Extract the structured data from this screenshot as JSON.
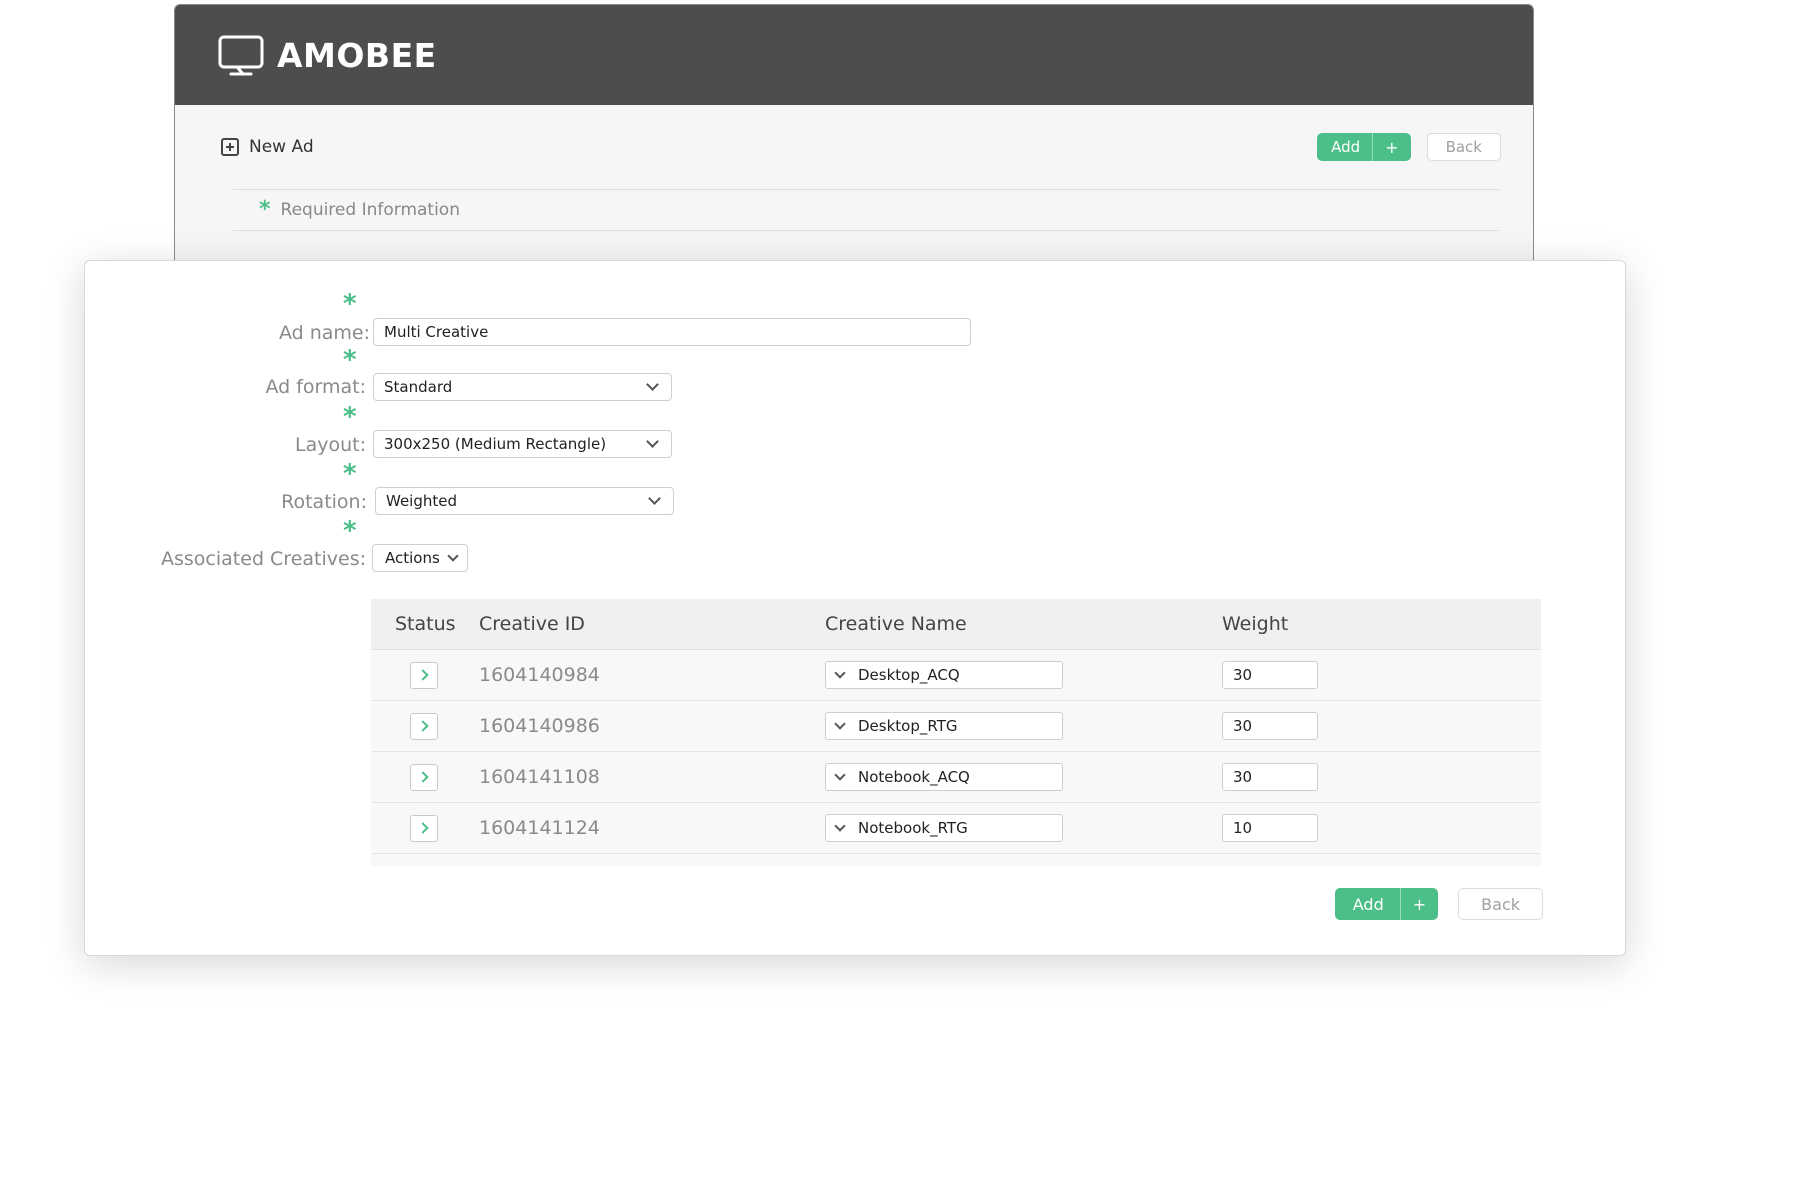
{
  "brand": {
    "name": "AMOBEE"
  },
  "toolbar": {
    "new_ad_label": "New Ad",
    "add_label": "Add",
    "add_plus": "+",
    "back_label": "Back"
  },
  "required": {
    "label": "Required Information",
    "marker": "*"
  },
  "form": {
    "ad_name": {
      "label": "Ad name:",
      "value": "Multi Creative"
    },
    "ad_format": {
      "label": "Ad format:",
      "value": "Standard"
    },
    "layout": {
      "label": "Layout:",
      "value": "300x250 (Medium Rectangle)"
    },
    "rotation": {
      "label": "Rotation:",
      "value": "Weighted"
    },
    "associated_creatives": {
      "label": "Associated Creatives:",
      "actions_label": "Actions"
    }
  },
  "table": {
    "columns": [
      "Status",
      "Creative ID",
      "Creative Name",
      "Weight"
    ],
    "rows": [
      {
        "id": "1604140984",
        "name": "Desktop_ACQ",
        "weight": "30"
      },
      {
        "id": "1604140986",
        "name": "Desktop_RTG",
        "weight": "30"
      },
      {
        "id": "1604141108",
        "name": "Notebook_ACQ",
        "weight": "30"
      },
      {
        "id": "1604141124",
        "name": "Notebook_RTG",
        "weight": "10"
      }
    ]
  },
  "footer": {
    "add_label": "Add",
    "add_plus": "+",
    "back_label": "Back"
  },
  "colors": {
    "accent": "#4bbf87",
    "header_bg": "#4d4d4d"
  }
}
